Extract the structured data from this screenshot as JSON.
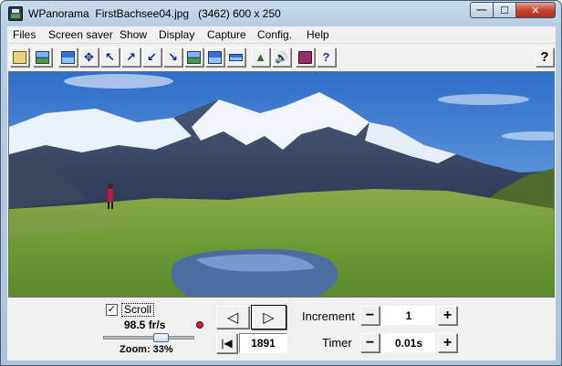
{
  "window": {
    "app_name": "WPanorama",
    "title": "WPanorama  FirstBachsee04.jpg   (3462) 600 x 250",
    "minimize_label": "—",
    "maximize_label": "☐",
    "close_label": "✕"
  },
  "menu": {
    "items": [
      "Files",
      "Screen saver",
      "Show",
      "Display",
      "Capture",
      "Config.",
      "Help"
    ]
  },
  "toolbar": {
    "buttons": [
      "open-file-icon",
      "landscape-icon",
      "window-icon",
      "move-icon",
      "shrink-icon",
      "diagonal-up-icon",
      "diagonal-down-icon",
      "diagonal-corner-icon",
      "image-fit-icon",
      "panorama-icon",
      "flat-panorama-icon",
      "tree-icon",
      "sound-icon",
      "book-icon",
      "help-book-icon"
    ],
    "help_label": "?"
  },
  "controls": {
    "scroll_checked_glyph": "✓",
    "scroll_label": "Scroll",
    "fps": "98.5 fr/s",
    "zoom": "Zoom: 33%",
    "zoom_level_fraction": 0.33,
    "prev_glyph": "◁",
    "next_glyph": "▷",
    "first_glyph": "|◀",
    "frame_value": "1891",
    "increment_label": "Increment",
    "increment_value": "1",
    "timer_label": "Timer",
    "timer_value": "0.01s",
    "minus_glyph": "−",
    "plus_glyph": "+"
  },
  "colors": {
    "sky": "#3f7fd1",
    "meadow": "#6d9a36",
    "close_button": "#c7432d"
  }
}
